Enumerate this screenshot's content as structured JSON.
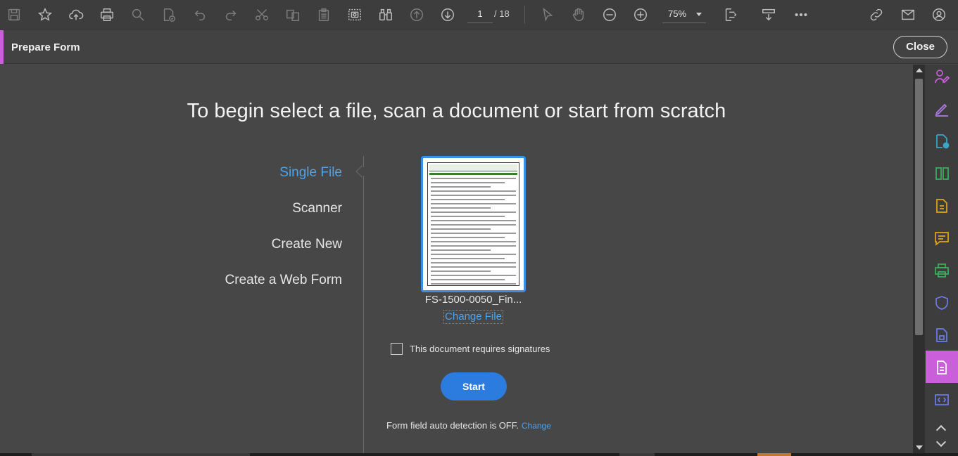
{
  "toolbar": {
    "page_current": "1",
    "page_total": "/ 18",
    "zoom": "75%",
    "icons": [
      "save-icon",
      "star-icon",
      "upload-cloud-icon",
      "print-icon",
      "search-icon",
      "spellcheck-icon",
      "undo-icon",
      "redo-icon",
      "cut-icon",
      "copy-icon",
      "paste-icon",
      "snapshot-icon",
      "find-binoculars-icon",
      "page-up-icon",
      "page-down-icon",
      "select-cursor-icon",
      "hand-tool-icon",
      "zoom-out-icon",
      "zoom-in-icon",
      "page-display-icon",
      "scroll-mode-icon",
      "more-icon",
      "share-link-icon",
      "email-icon",
      "account-icon"
    ]
  },
  "subheader": {
    "title": "Prepare Form",
    "close_label": "Close"
  },
  "main": {
    "heading": "To begin select a file, scan a document or start from scratch",
    "options": [
      {
        "label": "Single File"
      },
      {
        "label": "Scanner"
      },
      {
        "label": "Create New"
      },
      {
        "label": "Create a Web Form"
      }
    ],
    "file_name": "FS-1500-0050_Fin...",
    "change_file_label": "Change File",
    "signature_label": "This document requires signatures",
    "start_label": "Start",
    "autodetect_text": "Form field auto detection is OFF.",
    "autodetect_link": "Change"
  },
  "rightpane": {
    "icons": [
      "request-signature-icon",
      "fill-sign-icon",
      "create-pdf-icon",
      "organize-pages-icon",
      "export-pdf-icon",
      "comment-icon",
      "print-production-icon",
      "protect-icon",
      "scan-ocr-icon",
      "prepare-form-icon",
      "javascript-icon"
    ]
  },
  "colors": {
    "accent": "#c95fd9",
    "link": "#4da3ec",
    "primary_button": "#2c7ce0"
  }
}
